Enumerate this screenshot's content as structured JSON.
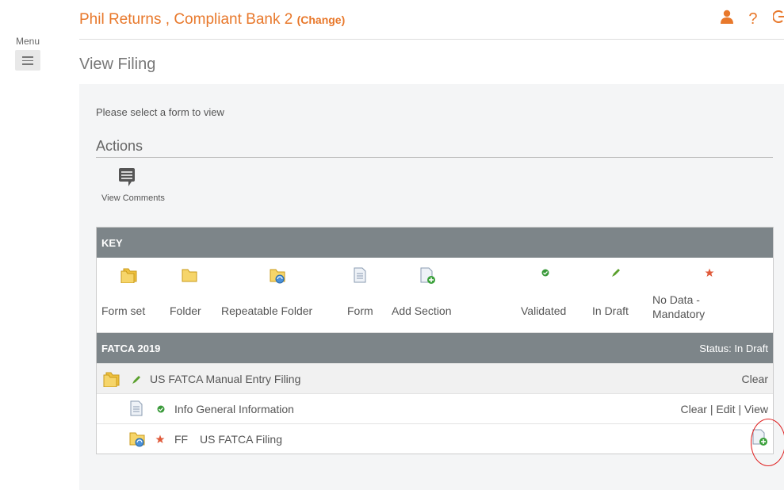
{
  "menu": {
    "label": "Menu"
  },
  "header": {
    "title": "Phil Returns , Compliant Bank 2",
    "change_label": "(Change)",
    "icons": [
      "user-icon",
      "help-icon",
      "logout-icon"
    ],
    "accent": "#e8782b"
  },
  "page": {
    "title": "View Filing",
    "prompt": "Please select a form to view"
  },
  "actions": {
    "title": "Actions",
    "view_comments": "View Comments"
  },
  "key": {
    "title": "KEY",
    "items": [
      {
        "label": "Form set",
        "icon": "form-set-icon"
      },
      {
        "label": "Folder",
        "icon": "folder-icon"
      },
      {
        "label": "Repeatable Folder",
        "icon": "repeatable-folder-icon"
      },
      {
        "label": "Form",
        "icon": "form-icon"
      },
      {
        "label": "Add Section",
        "icon": "add-section-icon"
      },
      {
        "label": "Validated",
        "icon": "validated-icon"
      },
      {
        "label": "In Draft",
        "icon": "in-draft-icon"
      },
      {
        "label": "No Data - Mandatory",
        "icon": "mandatory-icon"
      }
    ]
  },
  "filing": {
    "title": "FATCA 2019",
    "status": "Status: In Draft",
    "rows": [
      {
        "name": "US FATCA Manual Entry Filing",
        "clear": "Clear"
      },
      {
        "name": "Info General Information",
        "clear": "Clear",
        "sep": "|",
        "edit": "Edit",
        "view": "View"
      },
      {
        "code": "FF",
        "name": "US FATCA Filing"
      }
    ]
  },
  "colors": {
    "header_bar": "#7d8589",
    "validated": "#3a9a3a",
    "draft": "#5aa02c",
    "mandatory": "#e05a3a"
  }
}
